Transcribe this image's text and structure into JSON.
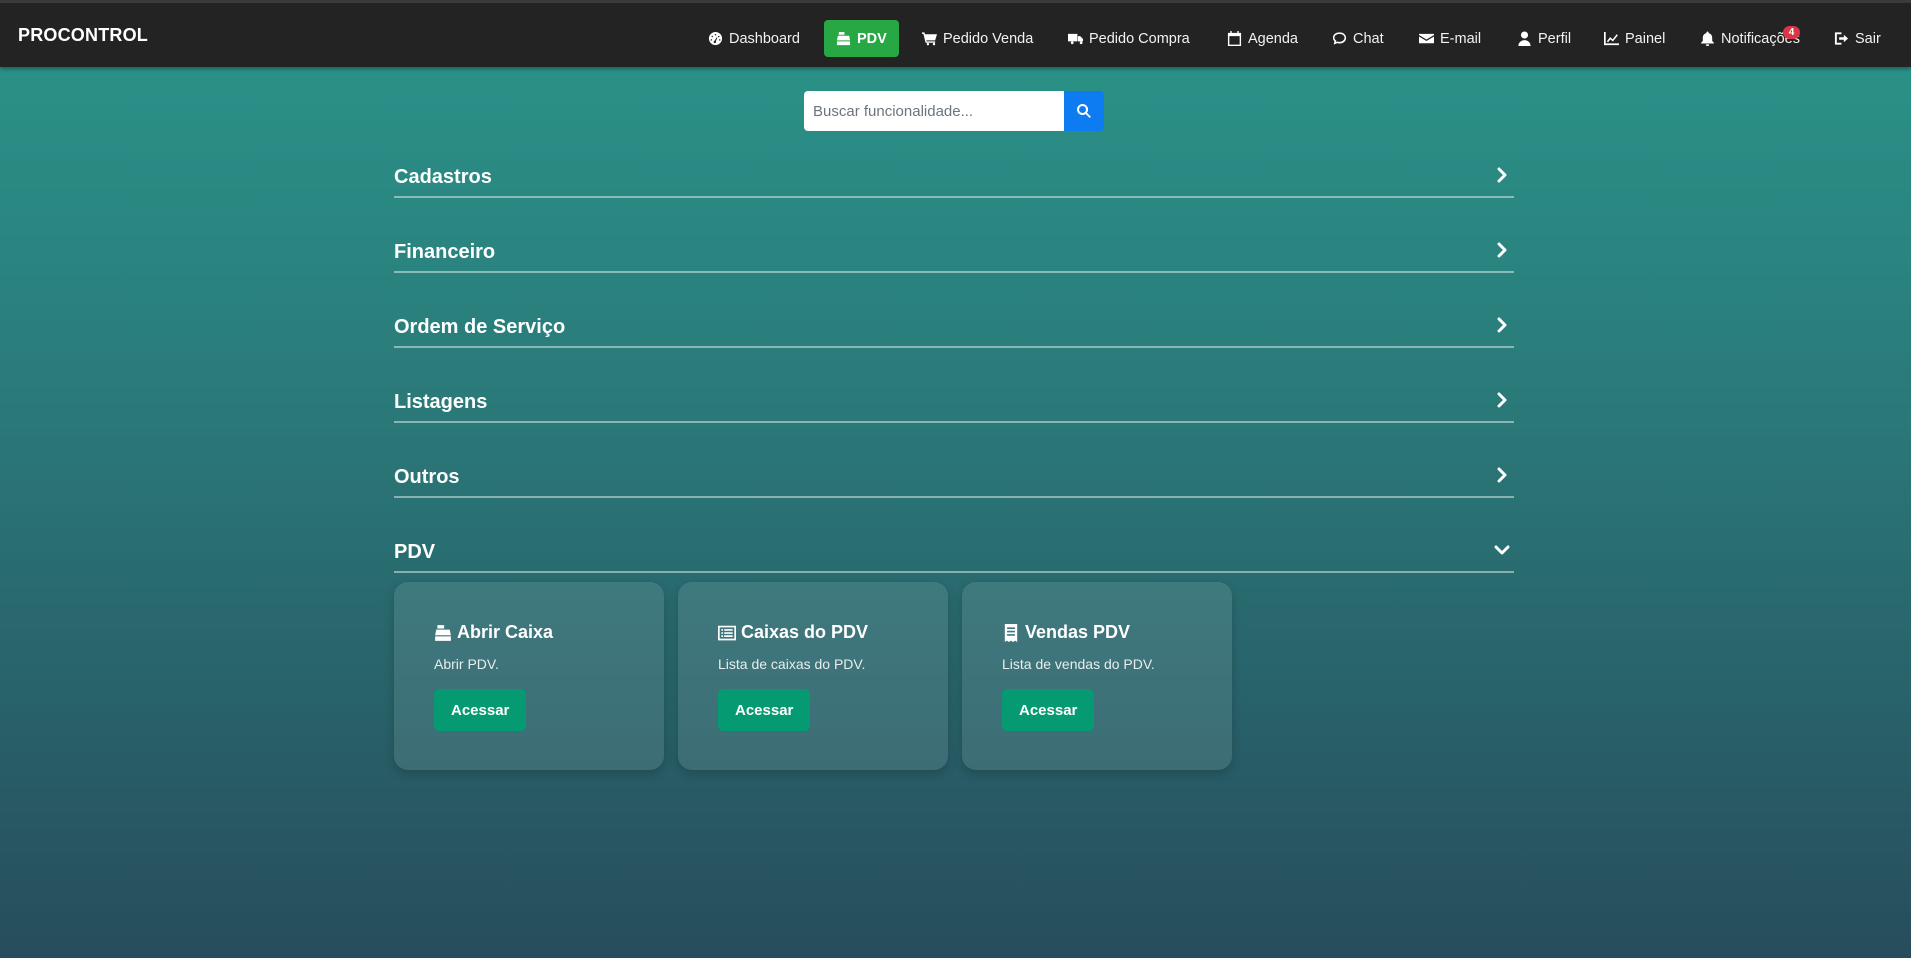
{
  "brand": "PROCONTROL",
  "nav": [
    {
      "label": "Dashboard",
      "icon": "dashboard-icon"
    },
    {
      "label": "PDV",
      "icon": "cash-register-icon",
      "active": true
    },
    {
      "label": "Pedido Venda",
      "icon": "cart-icon"
    },
    {
      "label": "Pedido Compra",
      "icon": "truck-icon"
    },
    {
      "label": "Agenda",
      "icon": "calendar-icon"
    },
    {
      "label": "Chat",
      "icon": "chat-icon"
    },
    {
      "label": "E-mail",
      "icon": "envelope-icon"
    },
    {
      "label": "Perfil",
      "icon": "user-icon"
    },
    {
      "label": "Painel",
      "icon": "chart-icon"
    },
    {
      "label": "Notificações",
      "icon": "bell-icon",
      "badge": "4"
    },
    {
      "label": "Sair",
      "icon": "sign-out-icon"
    }
  ],
  "search": {
    "placeholder": "Buscar funcionalidade..."
  },
  "sections": [
    {
      "title": "Cadastros",
      "expanded": false
    },
    {
      "title": "Financeiro",
      "expanded": false
    },
    {
      "title": "Ordem de Serviço",
      "expanded": false
    },
    {
      "title": "Listagens",
      "expanded": false
    },
    {
      "title": "Outros",
      "expanded": false
    },
    {
      "title": "PDV",
      "expanded": true
    }
  ],
  "cards": [
    {
      "title": "Abrir Caixa",
      "description": "Abrir PDV.",
      "button": "Acessar",
      "icon": "cash-register-icon"
    },
    {
      "title": "Caixas do PDV",
      "description": "Lista de caixas do PDV.",
      "button": "Acessar",
      "icon": "list-icon"
    },
    {
      "title": "Vendas PDV",
      "description": "Lista de vendas do PDV.",
      "button": "Acessar",
      "icon": "receipt-icon"
    }
  ],
  "colors": {
    "accent_active": "#28a745",
    "search_button": "#0d7cf2",
    "card_button": "#069a72",
    "badge": "#dc3545"
  }
}
